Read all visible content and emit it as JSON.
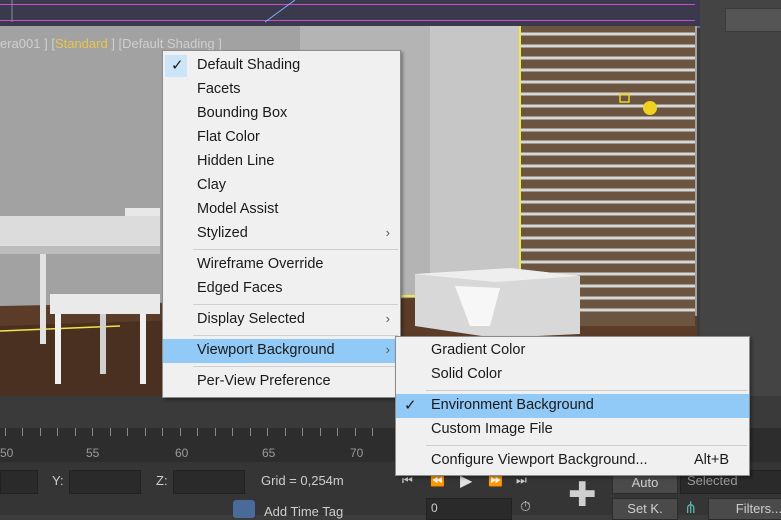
{
  "viewport": {
    "label_prefix": "era001 ] [",
    "label_view": "Standard",
    "label_suffix": " ] [Default Shading ]"
  },
  "shading_menu": {
    "items": [
      {
        "label": "Default Shading",
        "checked": true
      },
      {
        "label": "Facets"
      },
      {
        "label": "Bounding Box"
      },
      {
        "label": "Flat Color"
      },
      {
        "label": "Hidden Line"
      },
      {
        "label": "Clay"
      },
      {
        "label": "Model Assist"
      },
      {
        "label": "Stylized",
        "submenu": true
      },
      {
        "label": "Wireframe Override"
      },
      {
        "label": "Edged Faces"
      },
      {
        "label": "Display Selected",
        "submenu": true
      },
      {
        "label": "Viewport Background",
        "submenu": true,
        "highlighted": true
      },
      {
        "label": "Per-View Preference"
      }
    ]
  },
  "background_submenu": {
    "items": [
      {
        "label": "Gradient Color"
      },
      {
        "label": "Solid Color"
      },
      {
        "label": "Environment Background",
        "checked": true,
        "highlighted": true
      },
      {
        "label": "Custom Image File"
      },
      {
        "label": "Configure Viewport Background...",
        "shortcut": "Alt+B"
      }
    ]
  },
  "timeline": {
    "ticks": [
      "50",
      "55",
      "60",
      "65",
      "70"
    ]
  },
  "status": {
    "y_label": "Y:",
    "z_label": "Z:",
    "grid_text": "Grid = 0,254m",
    "add_time_tag": "Add Time Tag",
    "frame_value": "0",
    "auto_label": "Auto",
    "selected_label": "Selected",
    "setk_label": "Set K.",
    "filters_label": "Filters..."
  },
  "colors": {
    "menu_highlight": "#91c9f7",
    "selection_yellow": "#f0e64a"
  }
}
